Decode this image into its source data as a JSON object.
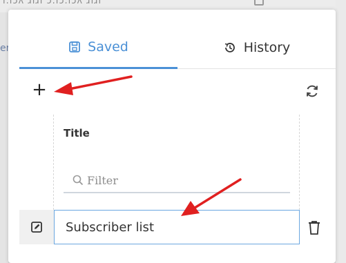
{
  "tabs": {
    "saved_label": "Saved",
    "history_label": "History"
  },
  "toolbar": {
    "add_label": "+"
  },
  "table": {
    "column_title": "Title",
    "filter_placeholder": "Filter",
    "rows": [
      {
        "title": "Subscriber list"
      }
    ]
  },
  "background": {
    "top_text": "ı.ıɔʎ ɹıɹı  ɔ.ıɔ.ıɔʎ ɹıɹı",
    "left_letter": "er"
  },
  "colors": {
    "accent": "#4a90d6",
    "arrow": "#e02020",
    "row_highlight_border": "#6aa6e0"
  },
  "icons": {
    "saved_tab": "save-icon",
    "history_tab": "history-icon",
    "refresh": "refresh-icon",
    "filter": "search-icon",
    "edit": "edit-icon",
    "delete": "trash-icon"
  }
}
